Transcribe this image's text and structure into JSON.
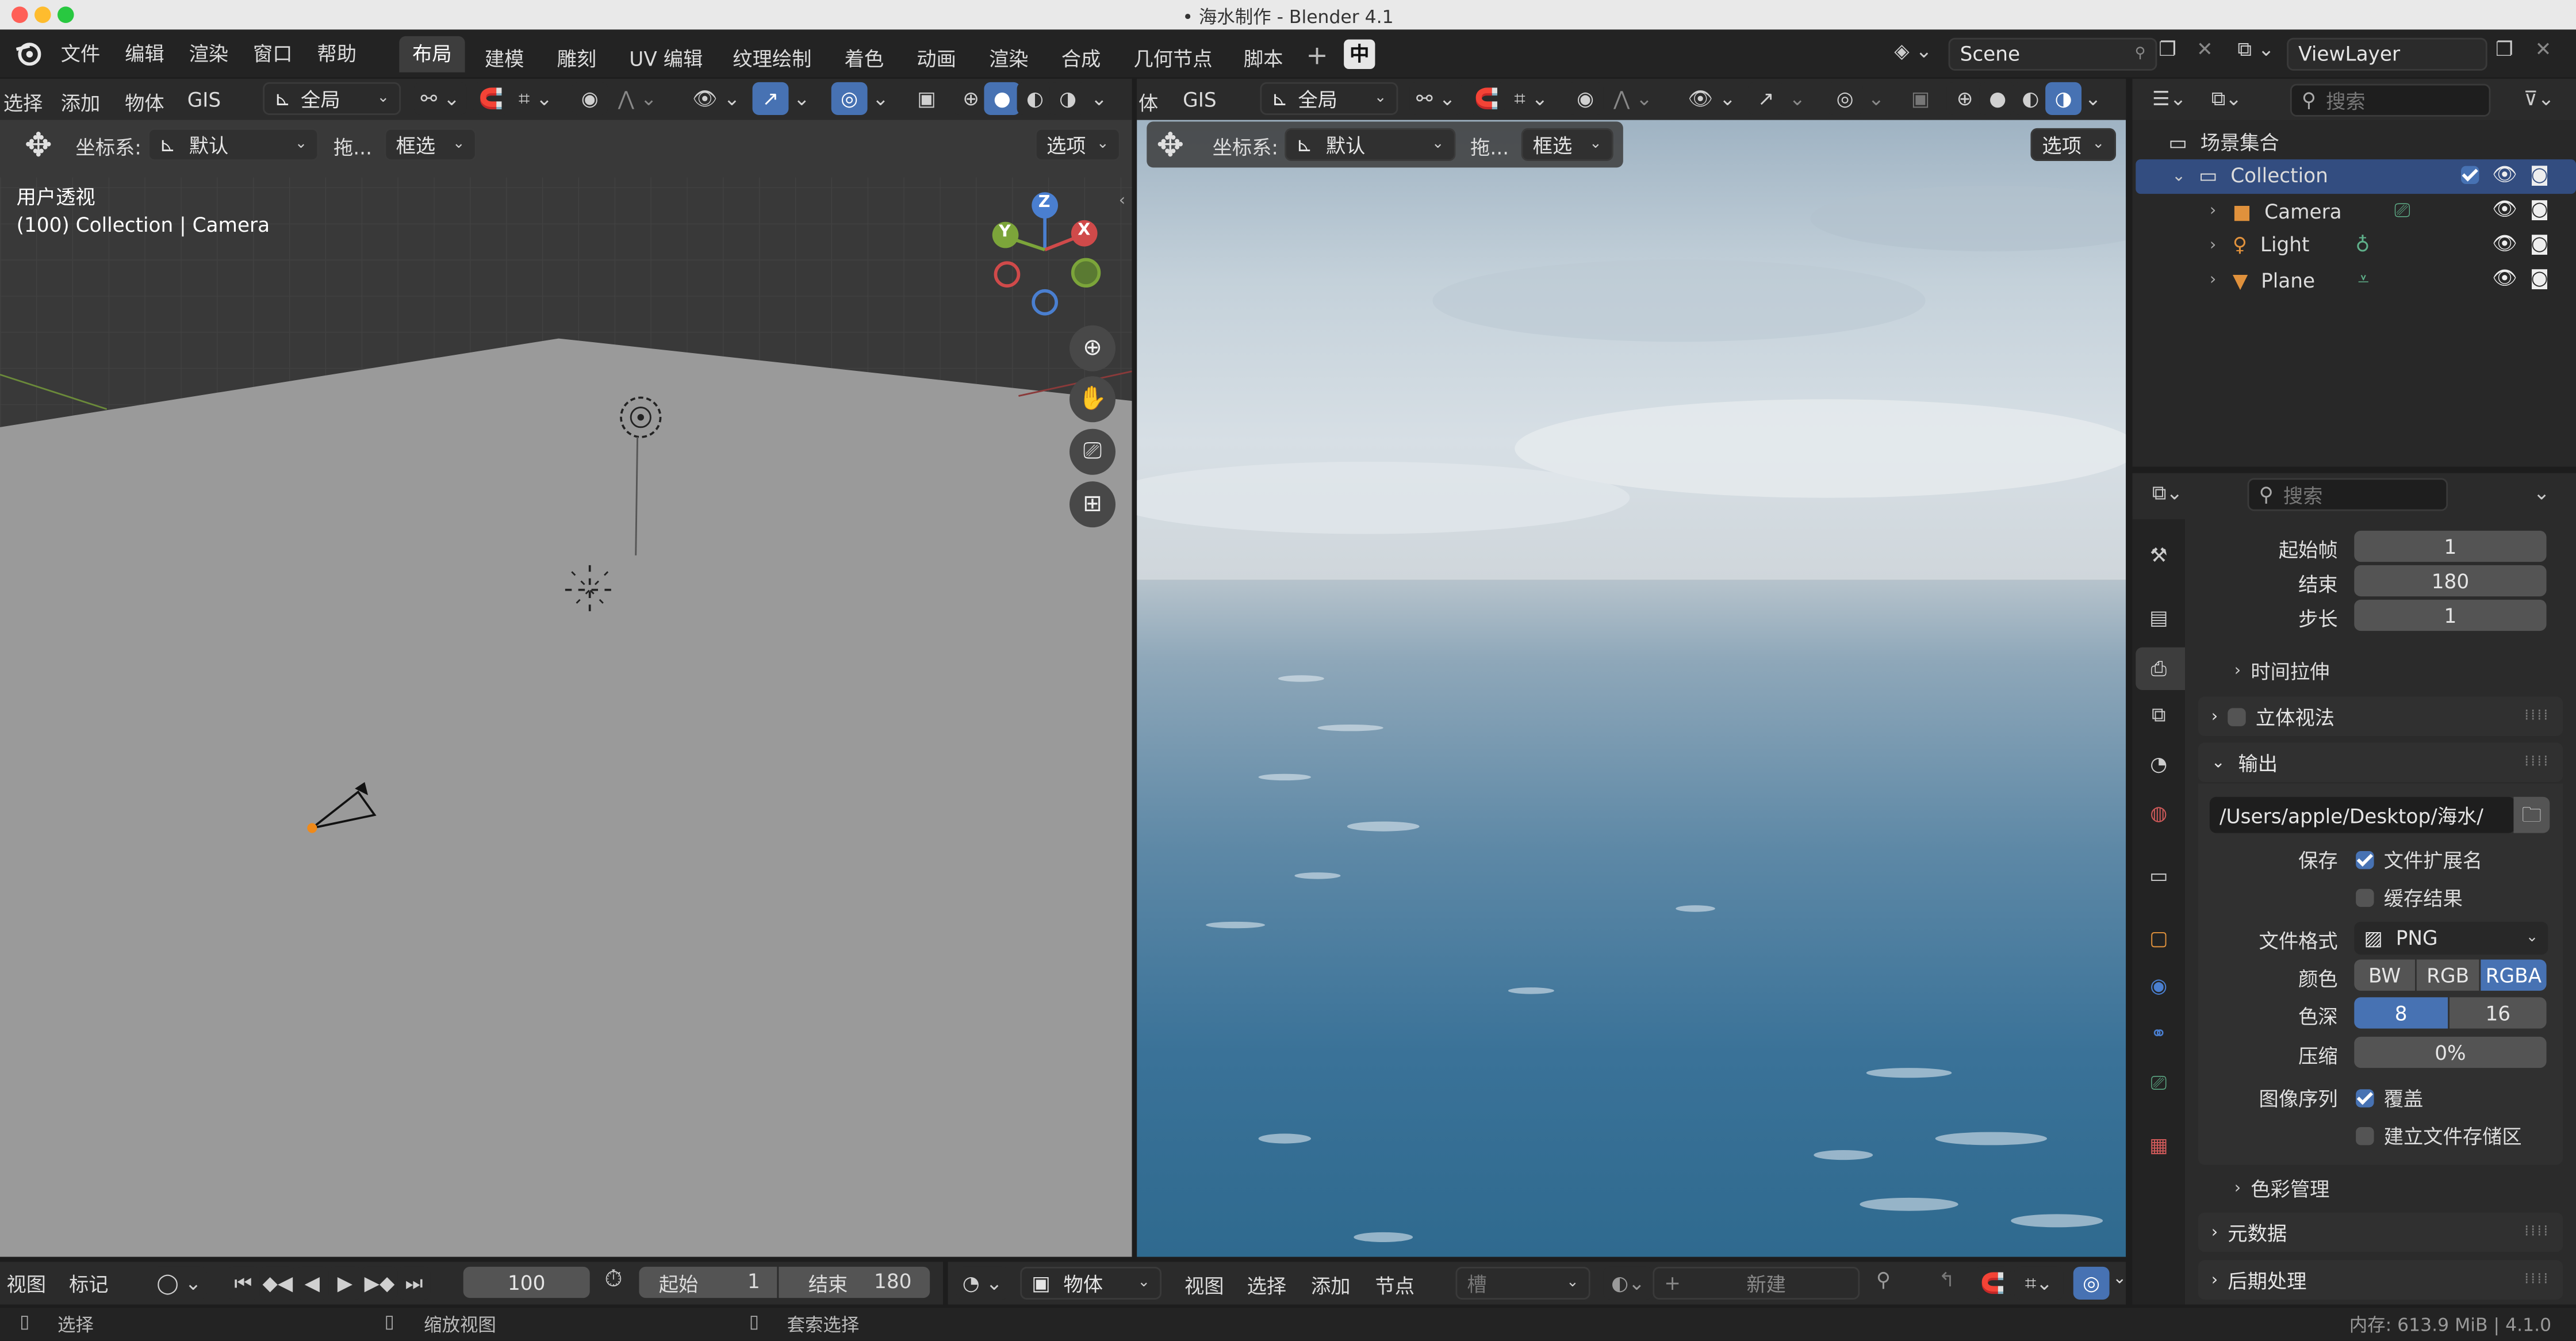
{
  "window": {
    "title": "• 海水制作 - Blender 4.1"
  },
  "topbar": {
    "menus": [
      "文件",
      "编辑",
      "渲染",
      "窗口",
      "帮助"
    ],
    "workspaces": [
      "布局",
      "建模",
      "雕刻",
      "UV 编辑",
      "纹理绘制",
      "着色",
      "动画",
      "渲染",
      "合成",
      "几何节点",
      "脚本"
    ],
    "active_workspace": "布局",
    "ime_label": "中",
    "scene": "Scene",
    "view_layer": "ViewLayer"
  },
  "viewport_left": {
    "menus": [
      "选择",
      "添加",
      "物体",
      "GIS"
    ],
    "orientation": "全局",
    "coord_label": "坐标系:",
    "coord_value": "默认",
    "drag_label": "拖...",
    "select_mode": "框选",
    "options": "选项",
    "view_name": "用户透视",
    "view_info": "(100) Collection | Camera",
    "gizmo_x": "X",
    "gizmo_y": "Y",
    "gizmo_z": "Z"
  },
  "viewport_right": {
    "menus": [
      "体",
      "GIS"
    ],
    "orientation": "全局",
    "coord_label": "坐标系:",
    "coord_value": "默认",
    "drag_label": "拖...",
    "select_mode": "框选",
    "options": "选项"
  },
  "outliner": {
    "search_placeholder": "搜索",
    "scene_collection": "场景集合",
    "collection": "Collection",
    "items": [
      {
        "name": "Camera",
        "type": "camera"
      },
      {
        "name": "Light",
        "type": "light"
      },
      {
        "name": "Plane",
        "type": "mesh"
      }
    ]
  },
  "properties": {
    "search_placeholder": "搜索",
    "frame_start_label": "起始帧",
    "frame_start": "1",
    "frame_end_label": "结束",
    "frame_end": "180",
    "frame_step_label": "步长",
    "frame_step": "1",
    "time_stretch": "时间拉伸",
    "stereoscopy": "立体视法",
    "output": "输出",
    "output_path": "/Users/apple/Desktop/海水/",
    "save_label": "保存",
    "file_extensions": "文件扩展名",
    "cache_result": "缓存结果",
    "file_format_label": "文件格式",
    "file_format": "PNG",
    "color_label": "颜色",
    "color_modes": [
      "BW",
      "RGB",
      "RGBA"
    ],
    "color_active": "RGBA",
    "depth_label": "色深",
    "depths": [
      "8",
      "16"
    ],
    "depth_active": "8",
    "compression_label": "压缩",
    "compression": "0%",
    "image_sequence_label": "图像序列",
    "overwrite": "覆盖",
    "placeholders": "建立文件存储区",
    "color_management": "色彩管理",
    "metadata": "元数据",
    "post_processing": "后期处理"
  },
  "timeline": {
    "view": "视图",
    "marker": "标记",
    "current_frame": "100",
    "start_label": "起始",
    "start": "1",
    "end_label": "结束",
    "end": "180"
  },
  "node_header": {
    "mode": "物体",
    "menus": [
      "视图",
      "选择",
      "添加",
      "节点"
    ],
    "slot": "槽",
    "new": "新建"
  },
  "statusbar": {
    "select": "选择",
    "zoom": "缩放视图",
    "lasso": "套索选择",
    "memory": "内存: 613.9 MiB | 4.1.0"
  },
  "colors": {
    "accent": "#4772b3",
    "viewport_floor": "#999999",
    "ocean_deep": "#2f6a8f",
    "sky": "#c9d6df"
  }
}
